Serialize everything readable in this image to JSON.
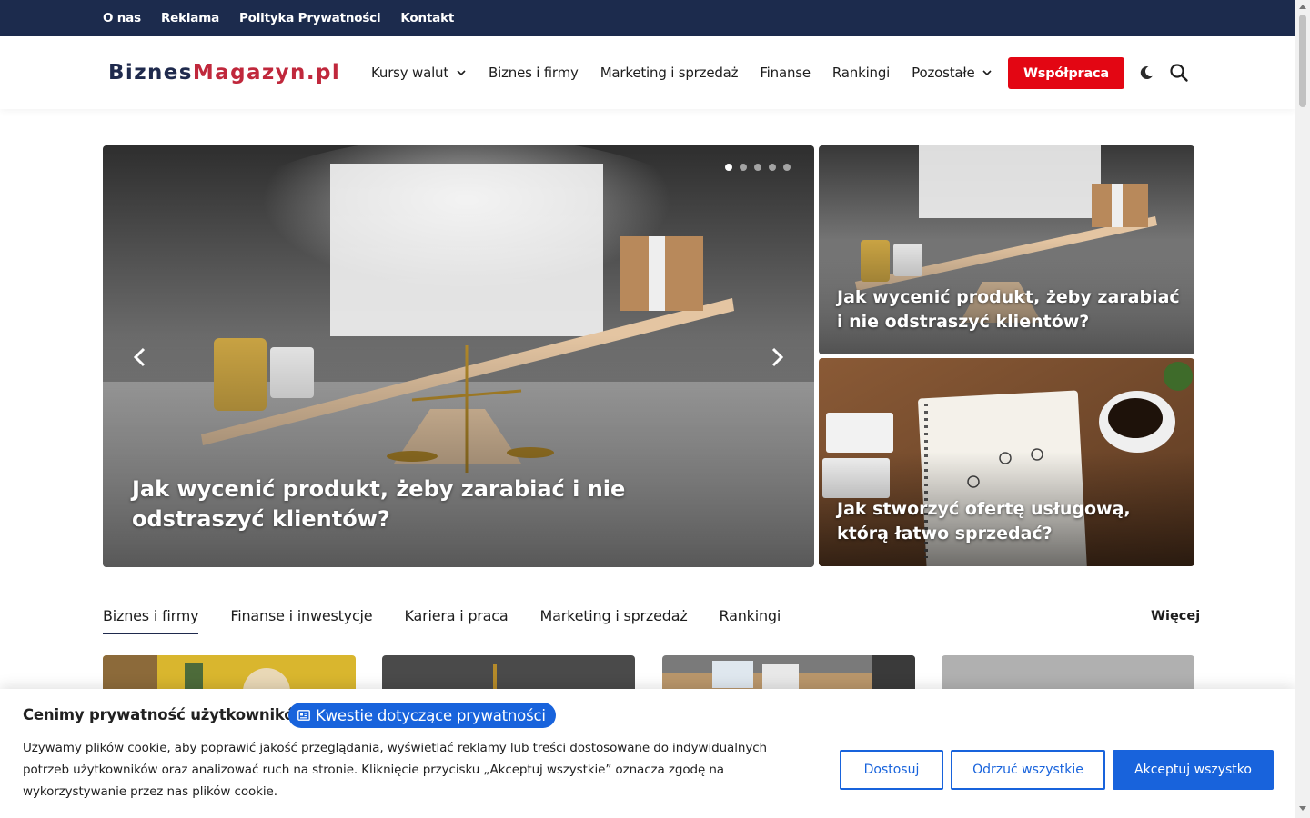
{
  "topbar": {
    "links": [
      "O nas",
      "Reklama",
      "Polityka Prywatności",
      "Kontakt"
    ]
  },
  "header": {
    "logo_part1": "Biznes",
    "logo_part2": "Magazyn.pl",
    "nav": [
      {
        "label": "Kursy walut",
        "dropdown": true
      },
      {
        "label": "Biznes i firmy",
        "dropdown": false
      },
      {
        "label": "Marketing i sprzedaż",
        "dropdown": false
      },
      {
        "label": "Finanse",
        "dropdown": false
      },
      {
        "label": "Rankingi",
        "dropdown": false
      },
      {
        "label": "Pozostałe",
        "dropdown": true
      }
    ],
    "cta_label": "Współpraca",
    "icons": [
      "moon-icon",
      "search-icon"
    ]
  },
  "hero": {
    "main_title": "Jak wycenić produkt, żeby zarabiać i nie odstraszyć klientów?",
    "slider_total": 5,
    "slider_active": 1,
    "side": [
      {
        "title": "Jak wycenić produkt, żeby zarabiać i nie odstraszyć klientów?"
      },
      {
        "title": "Jak stworzyć ofertę usługową, którą łatwo sprzedać?"
      }
    ]
  },
  "tabs": {
    "items": [
      "Biznes i firmy",
      "Finanse i inwestycje",
      "Kariera i praca",
      "Marketing i sprzedaż",
      "Rankingi"
    ],
    "active_index": 0,
    "more_label": "Więcej"
  },
  "cookie": {
    "title": "Cenimy prywatność użytkowników",
    "privacy_link": "Kwestie dotyczące prywatności",
    "text": "Używamy plików cookie, aby poprawić jakość przeglądania, wyświetlać reklamy lub treści dostosowane do indywidualnych potrzeb użytkowników oraz analizować ruch na stronie. Kliknięcie przycisku „Akceptuj wszystkie” oznacza zgodę na wykorzystywanie przez nas plików cookie.",
    "btn_customize": "Dostosuj",
    "btn_reject": "Odrzuć wszystkie",
    "btn_accept": "Akceptuj wszystko"
  },
  "colors": {
    "topbar": "#1c2b4d",
    "cta": "#e30613",
    "cookie_blue": "#1863dc",
    "logo_red": "#c0283c",
    "logo_navy": "#1f2a4d"
  }
}
